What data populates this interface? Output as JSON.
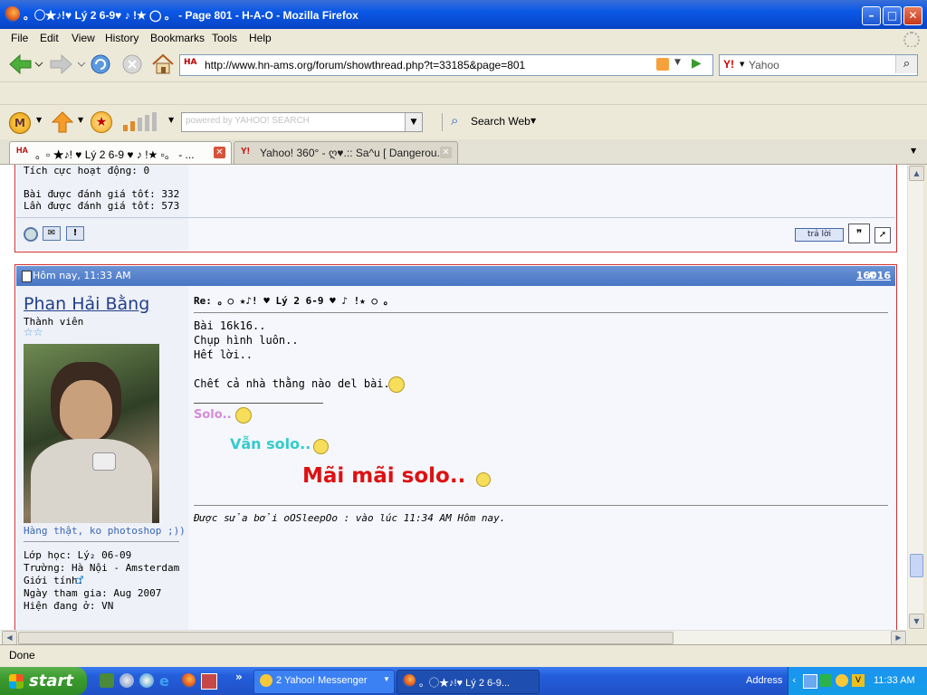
{
  "window": {
    "title": "。◯★♪!♥ Lý 2 6-9♥ ♪ !★ ◯ 。 - Page 801 - H-A-O - Mozilla Firefox",
    "min": "–",
    "max": "□",
    "close": "✕"
  },
  "menu": {
    "file": "File",
    "edit": "Edit",
    "view": "View",
    "history": "History",
    "bookmarks": "Bookmarks",
    "tools": "Tools",
    "help": "Help"
  },
  "nav": {
    "url": "http://www.hn-ams.org/forum/showthread.php?t=33185&page=801",
    "search_engine_icon": "Y!",
    "search_placeholder": "Yahoo"
  },
  "yahoo_toolbar": {
    "search_placeholder": "powered by YAHOO! SEARCH",
    "search_web": "Search Web"
  },
  "tabs": [
    {
      "label": "。▫ ★♪! ♥ Lý 2 6-9 ♥ ♪ !★ ▫。 - ...",
      "icon": "HA",
      "active": true
    },
    {
      "label": "Yahoo! 360° - ღ♥.:: Sa^u [ Dangerou...",
      "icon": "Y!",
      "active": false
    }
  ],
  "prev_post": {
    "activity": "Tích cực hoạt động: 0",
    "good_posts": "Bài được đánh giá tốt: 332",
    "good_times": "Lần được đánh giá tốt: 573",
    "reply_button": "trả lời"
  },
  "post": {
    "date": "Hôm nay, 11:33 AM",
    "hash": "#",
    "number": "16016",
    "username": "Phan Hải Bằng",
    "role": "Thành viên",
    "stars": "☆☆",
    "avatar_caption": "Hàng thật, ko photoshop ;))",
    "class": "Lớp học: Lý₂ 06-09",
    "school": "Trường: Hà Nội - Amsterdam",
    "gender": "Giới tính:",
    "join": "Ngày tham gia: Aug 2007",
    "location": "Hiện đang ở: VN",
    "title": "Re: 。○ ★♪! ♥ Lý 2 6-9 ♥ ♪ !★ ○ 。",
    "body": [
      "Bài 16k16..",
      "Chụp hình luôn..",
      "Hết lời..",
      "Chết cả nhà thằng nào del bài.."
    ],
    "solo1": "Solo..",
    "solo2": "Vẫn solo..",
    "solo3": "Mãi mãi solo..",
    "edit_note": "Được sửa bởi oOSleepOo : vào lúc 11:34 AM Hôm nay.",
    "colors": {
      "solo1": "#d68ad6",
      "solo2": "#33cccc",
      "solo3": "#dd1111"
    }
  },
  "status": "Done",
  "taskbar": {
    "start": "start",
    "tasks": [
      "2 Yahoo! Messenger",
      "。◯★♪!♥ Lý 2 6-9..."
    ],
    "address": "Address",
    "clock": "11:33 AM"
  }
}
